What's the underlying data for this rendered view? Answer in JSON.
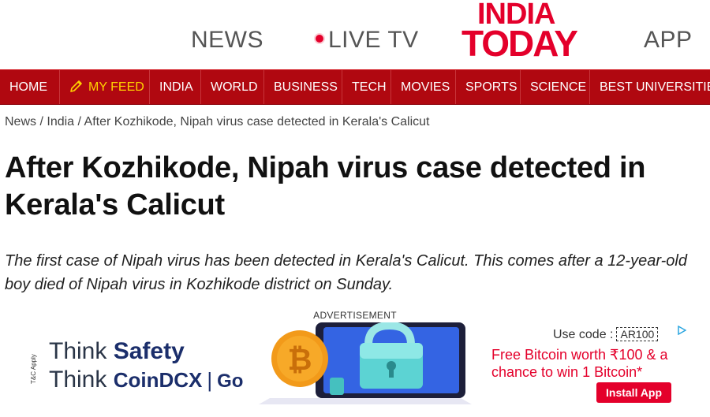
{
  "header": {
    "news_label": "NEWS",
    "livetv_label": "LIVE TV",
    "logo_line1": "INDIA",
    "logo_line2": "TODAY",
    "app_label": "APP"
  },
  "nav": {
    "items": [
      "HOME",
      "MY FEED",
      "INDIA",
      "WORLD",
      "BUSINESS",
      "TECH",
      "MOVIES",
      "SPORTS",
      "SCIENCE",
      "BEST UNIVERSITIES"
    ]
  },
  "breadcrumb": {
    "items": [
      "News",
      "India",
      "After Kozhikode, Nipah virus case detected in Kerala's Calicut"
    ],
    "separator": "/"
  },
  "article": {
    "title": "After Kozhikode, Nipah virus case detected in Kerala's Calicut",
    "summary": "The first case of Nipah virus has been detected in Kerala's Calicut. This comes after a 12-year-old boy died of Nipah virus in Kozhikode district on Sunday."
  },
  "ad": {
    "label": "ADVERTISEMENT",
    "tc": "T&C Apply",
    "think": "Think",
    "safety": "Safety",
    "coindcx": "CoinDCX",
    "go": "Go",
    "use_code": "Use code :",
    "code": "AR100",
    "promo": "Free Bitcoin worth ₹100 & a chance to win 1 Bitcoin*",
    "install": "Install App"
  },
  "colors": {
    "brand_red": "#e4002b",
    "nav_bg": "#b00810",
    "my_feed": "#ffd200"
  }
}
